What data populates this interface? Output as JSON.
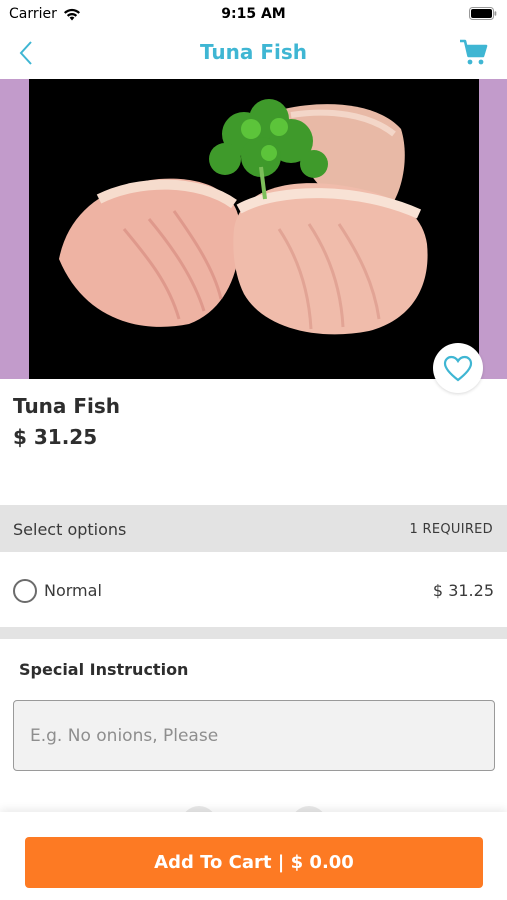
{
  "status_bar": {
    "carrier": "Carrier",
    "time": "9:15 AM"
  },
  "nav": {
    "title": "Tuna Fish",
    "back_icon": "chevron-left-icon",
    "cart_icon": "shopping-cart-icon"
  },
  "product": {
    "name": "Tuna Fish",
    "price": "$ 31.25",
    "favorite_icon": "heart-outline-icon"
  },
  "options": {
    "title": "Select options",
    "required_label": "1 REQUIRED",
    "items": [
      {
        "label": "Normal",
        "price": "$ 31.25",
        "selected": false
      }
    ]
  },
  "special_instruction": {
    "title": "Special Instruction",
    "placeholder": "E.g. No onions, Please",
    "value": ""
  },
  "cart_button": {
    "label": "Add To Cart",
    "separator": "|",
    "total": "$ 0.00"
  },
  "colors": {
    "accent": "#3fb6d3",
    "cta": "#fd7a23",
    "hero_background": "#c29bcb",
    "section_band": "#e3e3e3"
  }
}
